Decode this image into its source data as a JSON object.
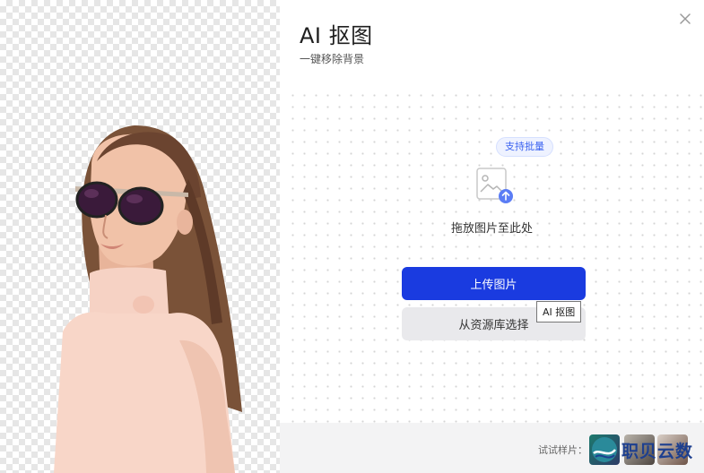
{
  "header": {
    "title": "AI 抠图",
    "subtitle": "一键移除背景"
  },
  "dropzone": {
    "badge": "支持批量",
    "text": "拖放图片至此处"
  },
  "actions": {
    "upload_label": "上传图片",
    "library_label": "从资源库选择",
    "tooltip": "AI 抠图"
  },
  "footer": {
    "label": "试试样片：",
    "samples": [
      "sample-1",
      "sample-2",
      "sample-3"
    ],
    "watermark": "职贝云数"
  },
  "colors": {
    "primary": "#1a3be0",
    "badge_text": "#3b63f0",
    "secondary_button": "#e9e9ec",
    "footer_bg": "#f3f3f4"
  },
  "icons": [
    "close-icon",
    "image-upload-icon",
    "watermark-logo-icon"
  ]
}
